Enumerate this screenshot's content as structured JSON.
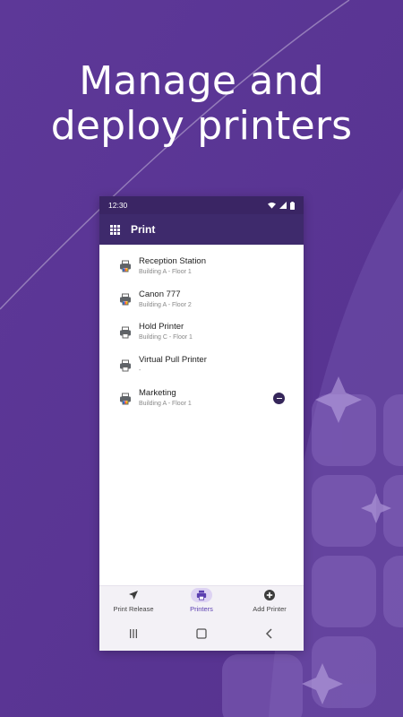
{
  "promo": {
    "line1": "Manage and",
    "line2": "deploy printers"
  },
  "statusbar": {
    "time": "12:30",
    "icons": [
      "wifi-icon",
      "signal-icon",
      "battery-icon"
    ]
  },
  "appbar": {
    "icon": "apps-grid-icon",
    "title": "Print"
  },
  "printers": [
    {
      "name": "Reception Station",
      "location": "Building A - Floor 1",
      "icon": "color-printer-icon"
    },
    {
      "name": "Canon 777",
      "location": "Building A - Floor 2",
      "icon": "color-printer-icon"
    },
    {
      "name": "Hold Printer",
      "location": "Building C - Floor 1",
      "icon": "mono-printer-icon"
    },
    {
      "name": "Virtual Pull Printer",
      "location": "-",
      "icon": "mono-printer-icon"
    },
    {
      "name": "Marketing",
      "location": "Building A - Floor 1",
      "icon": "color-printer-icon",
      "removable": true
    }
  ],
  "bottom_nav": [
    {
      "label": "Print Release",
      "icon": "send-icon",
      "active": false
    },
    {
      "label": "Printers",
      "icon": "printer-icon",
      "active": true
    },
    {
      "label": "Add Printer",
      "icon": "add-circle-icon",
      "active": false
    }
  ],
  "system_nav": [
    "recents-icon",
    "home-icon",
    "back-icon"
  ],
  "colors": {
    "background": "#5a3596",
    "appbar": "#3e2a6c",
    "statusbar": "#3a2564",
    "accent": "#5b3fb0",
    "remove_badge": "#35265a"
  }
}
